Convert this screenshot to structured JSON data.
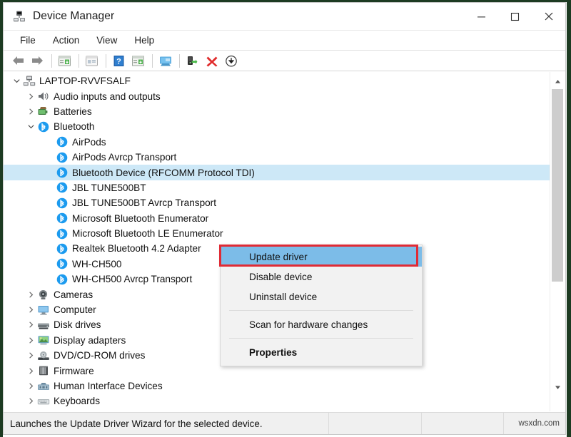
{
  "window": {
    "title": "Device Manager",
    "title_icon": "device-manager-icon",
    "controls": {
      "minimize": "—",
      "maximize": "☐",
      "close": "×"
    }
  },
  "menu_bar": {
    "items": [
      "File",
      "Action",
      "View",
      "Help"
    ]
  },
  "toolbar": {
    "buttons": [
      {
        "name": "back-icon",
        "glyph": "back-arrow"
      },
      {
        "name": "forward-icon",
        "glyph": "forward-arrow"
      },
      {
        "name": "separator",
        "glyph": "sep"
      },
      {
        "name": "properties-icon",
        "glyph": "properties"
      },
      {
        "name": "separator",
        "glyph": "sep"
      },
      {
        "name": "update-driver-icon",
        "glyph": "update-driver"
      },
      {
        "name": "separator",
        "glyph": "sep"
      },
      {
        "name": "help-icon",
        "glyph": "help"
      },
      {
        "name": "show-hidden-devices-icon",
        "glyph": "hidden-devices"
      },
      {
        "name": "separator",
        "glyph": "sep"
      },
      {
        "name": "scan-hardware-changes-icon",
        "glyph": "scan"
      },
      {
        "name": "separator",
        "glyph": "sep"
      },
      {
        "name": "enable-device-icon",
        "glyph": "enable"
      },
      {
        "name": "uninstall-device-icon",
        "glyph": "uninstall"
      },
      {
        "name": "disable-device-icon",
        "glyph": "disable"
      }
    ]
  },
  "tree": {
    "nodes": [
      {
        "label": "LAPTOP-RVVFSALF",
        "depth": 0,
        "twisty": "expanded",
        "icon": "computer-root-icon",
        "selected": false
      },
      {
        "label": "Audio inputs and outputs",
        "depth": 1,
        "twisty": "collapsed",
        "icon": "speaker-icon",
        "selected": false
      },
      {
        "label": "Batteries",
        "depth": 1,
        "twisty": "collapsed",
        "icon": "battery-icon",
        "selected": false
      },
      {
        "label": "Bluetooth",
        "depth": 1,
        "twisty": "expanded",
        "icon": "bluetooth-icon",
        "selected": false
      },
      {
        "label": "AirPods",
        "depth": 2,
        "twisty": "none",
        "icon": "bluetooth-icon",
        "selected": false
      },
      {
        "label": "AirPods Avrcp Transport",
        "depth": 2,
        "twisty": "none",
        "icon": "bluetooth-icon",
        "selected": false
      },
      {
        "label": "Bluetooth Device (RFCOMM Protocol TDI)",
        "depth": 2,
        "twisty": "none",
        "icon": "bluetooth-icon",
        "selected": true
      },
      {
        "label": "JBL TUNE500BT",
        "depth": 2,
        "twisty": "none",
        "icon": "bluetooth-icon",
        "selected": false
      },
      {
        "label": "JBL TUNE500BT Avrcp Transport",
        "depth": 2,
        "twisty": "none",
        "icon": "bluetooth-icon",
        "selected": false
      },
      {
        "label": "Microsoft Bluetooth Enumerator",
        "depth": 2,
        "twisty": "none",
        "icon": "bluetooth-icon",
        "selected": false
      },
      {
        "label": "Microsoft Bluetooth LE Enumerator",
        "depth": 2,
        "twisty": "none",
        "icon": "bluetooth-icon",
        "selected": false
      },
      {
        "label": "Realtek Bluetooth 4.2 Adapter",
        "depth": 2,
        "twisty": "none",
        "icon": "bluetooth-icon",
        "selected": false
      },
      {
        "label": "WH-CH500",
        "depth": 2,
        "twisty": "none",
        "icon": "bluetooth-icon",
        "selected": false
      },
      {
        "label": "WH-CH500 Avrcp Transport",
        "depth": 2,
        "twisty": "none",
        "icon": "bluetooth-icon",
        "selected": false
      },
      {
        "label": "Cameras",
        "depth": 1,
        "twisty": "collapsed",
        "icon": "camera-icon",
        "selected": false
      },
      {
        "label": "Computer",
        "depth": 1,
        "twisty": "collapsed",
        "icon": "monitor-icon",
        "selected": false
      },
      {
        "label": "Disk drives",
        "depth": 1,
        "twisty": "collapsed",
        "icon": "disk-icon",
        "selected": false
      },
      {
        "label": "Display adapters",
        "depth": 1,
        "twisty": "collapsed",
        "icon": "display-adapter-icon",
        "selected": false
      },
      {
        "label": "DVD/CD-ROM drives",
        "depth": 1,
        "twisty": "collapsed",
        "icon": "dvd-icon",
        "selected": false
      },
      {
        "label": "Firmware",
        "depth": 1,
        "twisty": "collapsed",
        "icon": "firmware-icon",
        "selected": false
      },
      {
        "label": "Human Interface Devices",
        "depth": 1,
        "twisty": "collapsed",
        "icon": "hid-icon",
        "selected": false
      },
      {
        "label": "Keyboards",
        "depth": 1,
        "twisty": "collapsed",
        "icon": "keyboard-icon",
        "selected": false
      }
    ]
  },
  "context_menu": {
    "items": [
      {
        "label": "Update driver",
        "highlighted": true,
        "bold": false
      },
      {
        "label": "Disable device",
        "highlighted": false,
        "bold": false
      },
      {
        "label": "Uninstall device",
        "highlighted": false,
        "bold": false
      },
      {
        "separator": true
      },
      {
        "label": "Scan for hardware changes",
        "highlighted": false,
        "bold": false
      },
      {
        "separator": true
      },
      {
        "label": "Properties",
        "highlighted": false,
        "bold": true
      }
    ]
  },
  "status_bar": {
    "text": "Launches the Update Driver Wizard for the selected device.",
    "watermark": "wsxdn.com"
  },
  "colors": {
    "highlight_blue": "#7cbce8",
    "selection_blue": "#cde8f7",
    "annotation_red": "#e02b35",
    "bluetooth_blue": "#1c9bef",
    "status_bg": "#f0f0f0"
  }
}
